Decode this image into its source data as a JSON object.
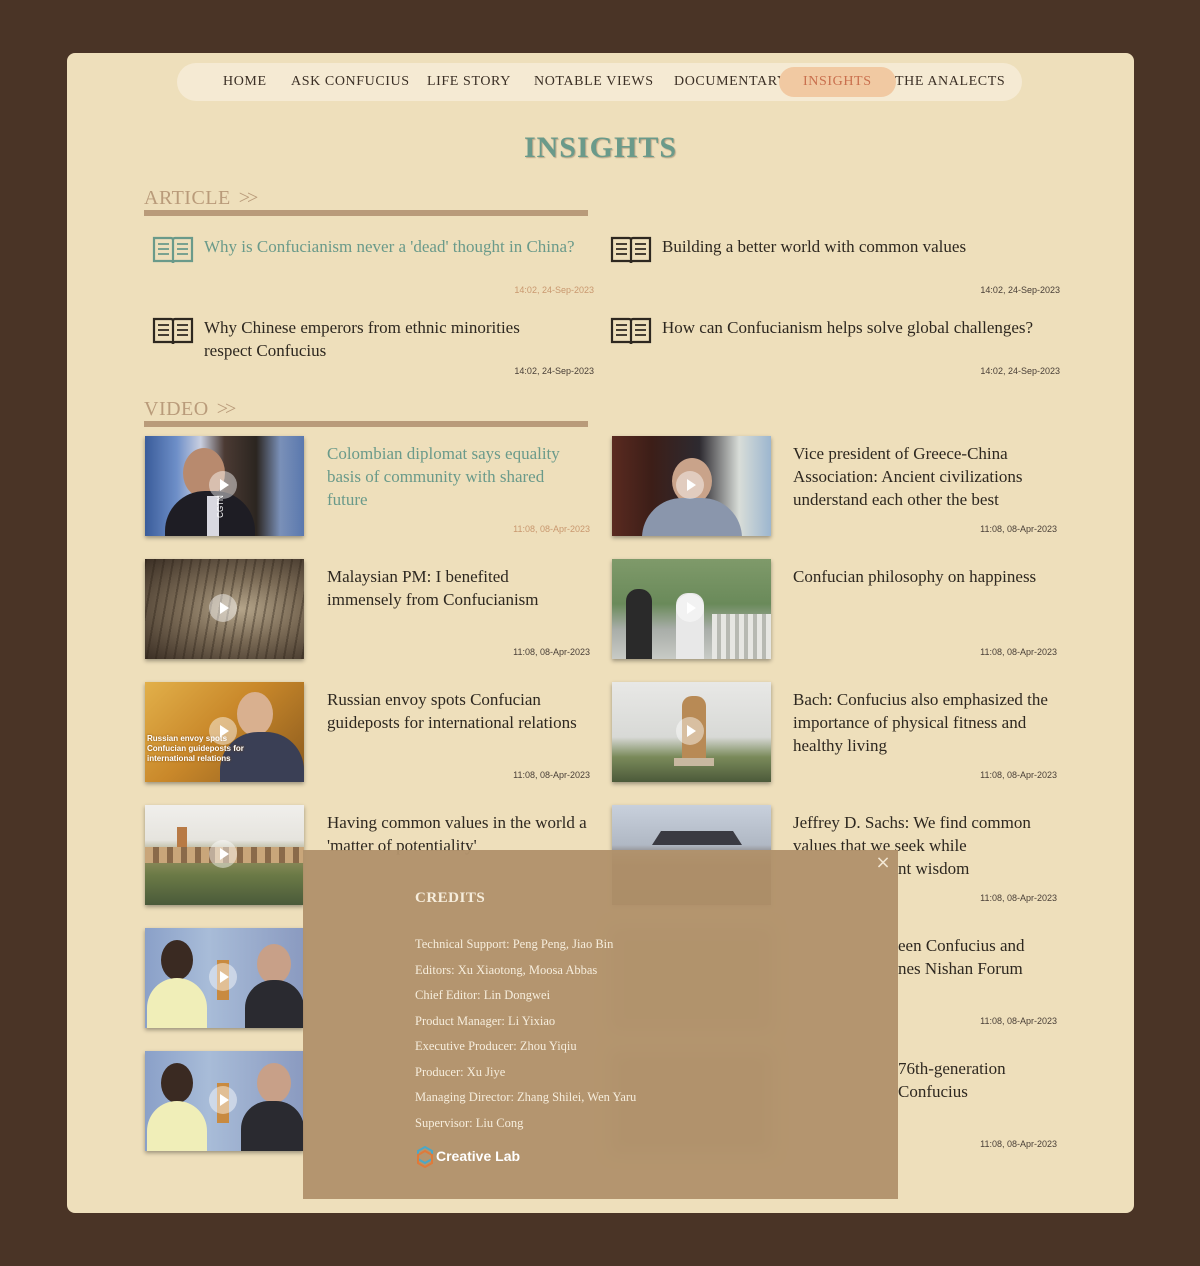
{
  "nav": {
    "items": [
      "HOME",
      "ASK CONFUCIUS",
      "LIFE STORY",
      "NOTABLE VIEWS",
      "DOCUMENTARY",
      "INSIGHTS",
      "THE ANALECTS"
    ],
    "active": "INSIGHTS"
  },
  "page_title": "INSIGHTS",
  "sections": {
    "article": "ARTICLE",
    "video": "VIDEO",
    "chevron": ">>"
  },
  "articles": [
    {
      "title": "Why is Confucianism never a 'dead' thought in China?",
      "time": "14:02, 24-Sep-2023",
      "highlighted": true
    },
    {
      "title": "Building a better world with common values",
      "time": "14:02, 24-Sep-2023"
    },
    {
      "title": "Why Chinese emperors from ethnic minorities respect Confucius",
      "time": "14:02, 24-Sep-2023"
    },
    {
      "title": "How can Confucianism helps solve global challenges?",
      "time": "14:02, 24-Sep-2023"
    }
  ],
  "videos": [
    {
      "title": "Colombian diplomat says equality basis of community with shared future",
      "time": "11:08, 08-Apr-2023",
      "highlighted": true,
      "thumb_text": "CGTN"
    },
    {
      "title": "Vice president of Greece-China Association: Ancient civilizations understand each other the best",
      "time": "11:08, 08-Apr-2023"
    },
    {
      "title": "Malaysian PM: I benefited immensely from Confucianism",
      "time": "11:08, 08-Apr-2023"
    },
    {
      "title": "Confucian philosophy on happiness",
      "time": "11:08, 08-Apr-2023"
    },
    {
      "title": "Russian envoy spots Confucian guideposts for international relations",
      "time": "11:08, 08-Apr-2023",
      "thumb_text": "Russian envoy spots Confucian guideposts for international relations"
    },
    {
      "title": "Bach: Confucius also emphasized the importance of physical fitness and healthy living",
      "time": "11:08, 08-Apr-2023"
    },
    {
      "title": "Having common values in the world a 'matter of potentiality'",
      "time": ""
    },
    {
      "title": "Jeffrey D. Sachs: We find common values that we seek while",
      "title_end": "nt wisdom",
      "time": "11:08, 08-Apr-2023"
    },
    {
      "title": "",
      "time": ""
    },
    {
      "title": "een Confucius and",
      "title_line2": "nes Nishan Forum",
      "time": "11:08, 08-Apr-2023"
    },
    {
      "title": "",
      "time": ""
    },
    {
      "title": "76th-generation",
      "title_line2": "Confucius",
      "time": "11:08, 08-Apr-2023"
    }
  ],
  "credits": {
    "heading": "CREDITS",
    "close": "×",
    "rows": [
      "Technical Support: Peng Peng, Jiao Bin",
      "Editors: Xu Xiaotong, Moosa Abbas",
      "Chief Editor: Lin Dongwei",
      "Product Manager: Li Yixiao",
      "Executive Producer: Zhou Yiqiu",
      "Producer: Xu Jiye",
      "Managing Director: Zhang Shilei, Wen Yaru",
      "Supervisor: Liu Cong"
    ],
    "lab": "Creative Lab"
  }
}
